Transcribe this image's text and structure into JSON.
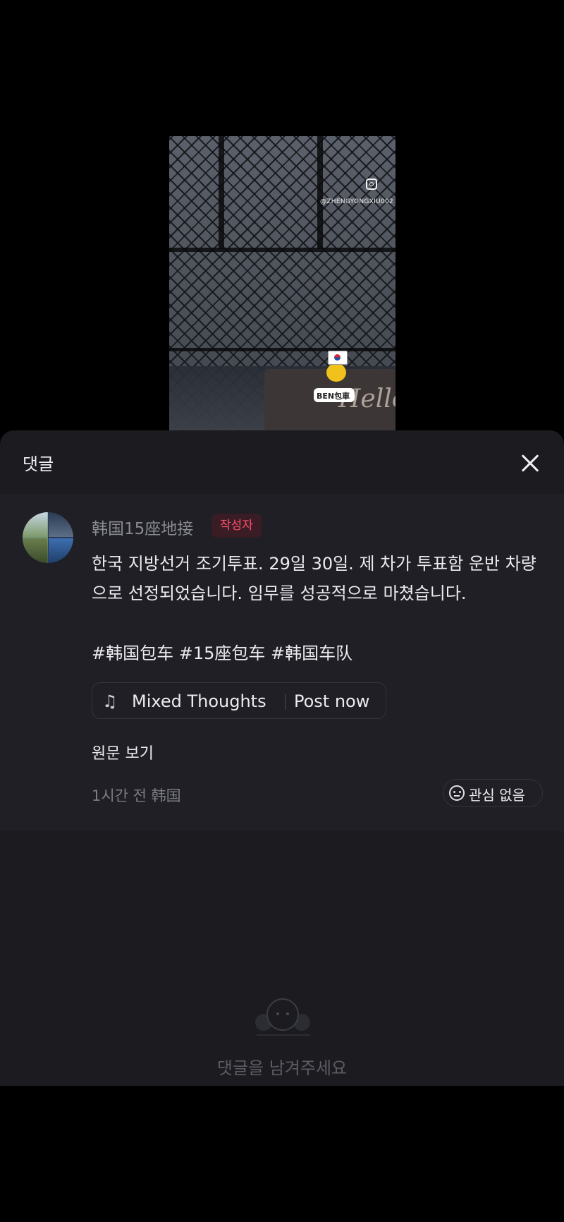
{
  "video": {
    "instagram_handle": "@ZHENGYONGXIU002",
    "sticker_text": "BEN包車",
    "mat_text": "Hello"
  },
  "sheet": {
    "title": "댓글",
    "close_icon": "close-icon"
  },
  "post": {
    "author": "韩国15座地接",
    "author_badge": "작성자",
    "text": "한국 지방선거 조기투표. 29일 30일. 제 차가 투표함 운반 차량으로 선정되었습니다. 임무를 성공적으로 마쳤습니다.",
    "hashtags": "#韩国包车 #15座包车 #韩国车队",
    "music": {
      "icon": "music-note-icon",
      "title": "Mixed Thoughts",
      "action": "Post now"
    },
    "view_original": "원문 보기",
    "meta": "1시간 전 韩国",
    "not_interested": "관심 없음"
  },
  "empty_state": {
    "icon": "chat-bubbles-icon",
    "text": "댓글을 남겨주세요"
  },
  "colors": {
    "sheet_bg": "#1b1b20",
    "post_bg": "#1f1f25",
    "badge_text": "#ff4d6a",
    "badge_bg": "#3a1d24"
  }
}
